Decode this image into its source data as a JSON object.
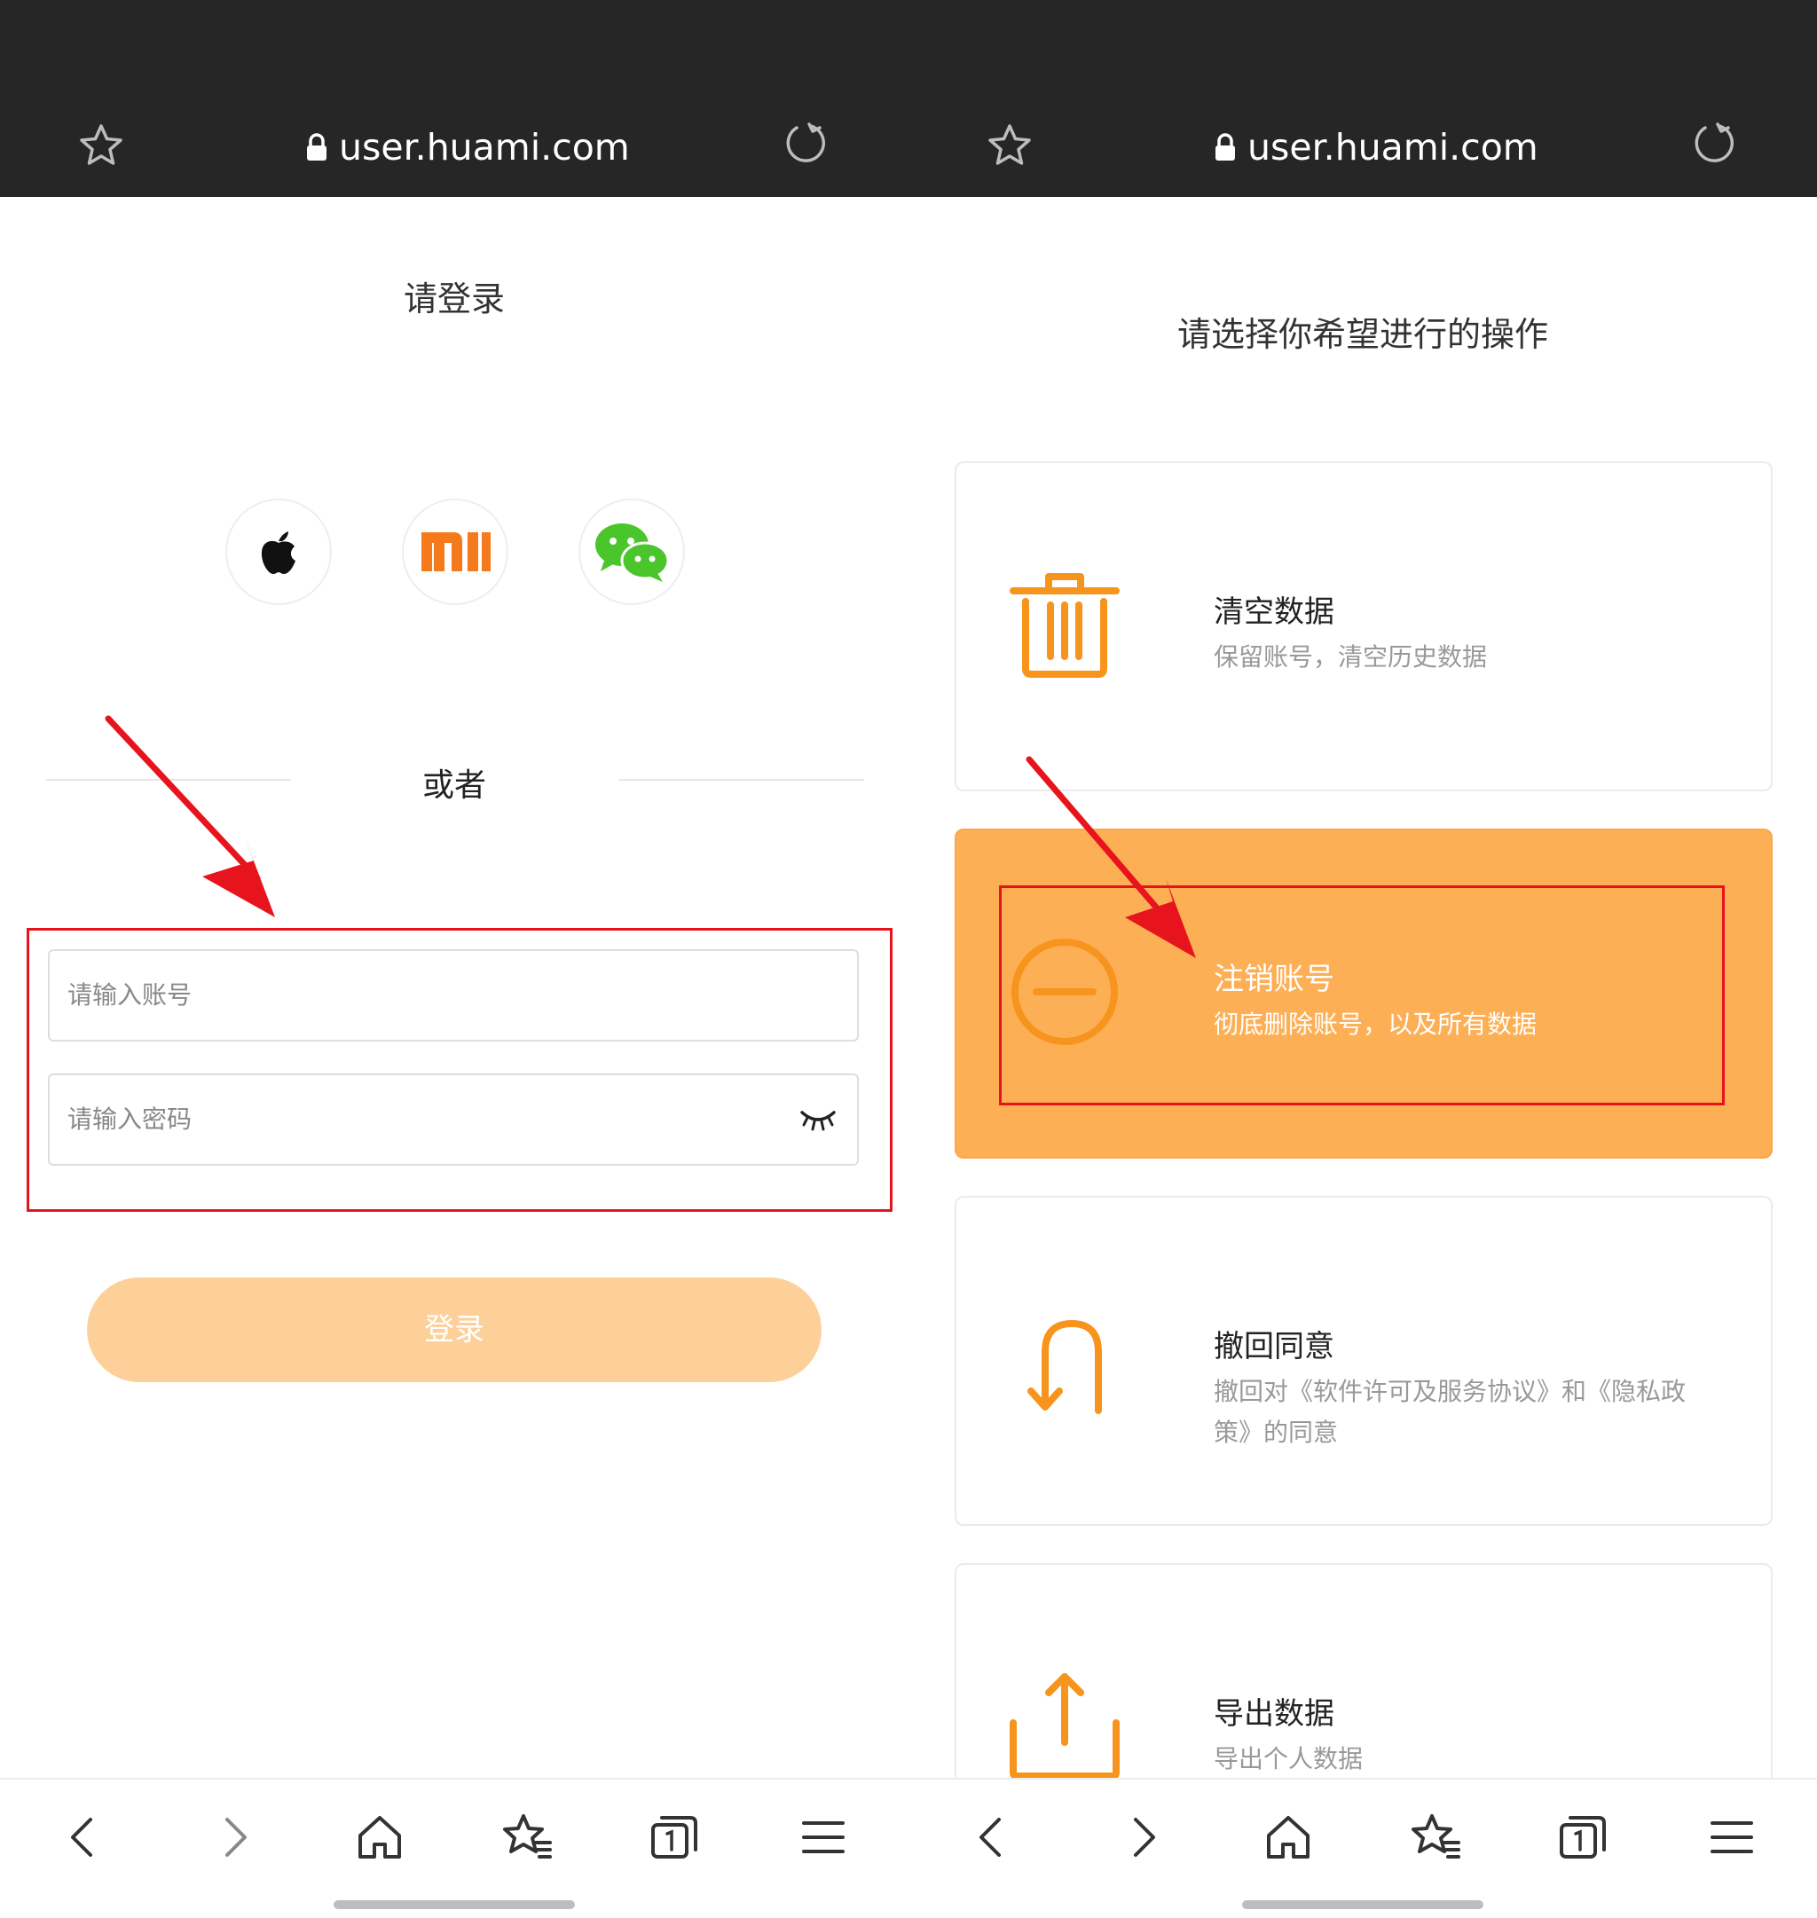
{
  "browser": {
    "url": "user.huami.com"
  },
  "login": {
    "title": "请登录",
    "social_options": [
      "apple",
      "xiaomi",
      "wechat"
    ],
    "separator": "或者",
    "account_placeholder": "请输入账号",
    "password_placeholder": "请输入密码",
    "login_button": "登录"
  },
  "operations": {
    "title": "请选择你希望进行的操作",
    "options": [
      {
        "title": "清空数据",
        "description": "保留账号，清空历史数据",
        "icon": "trash-icon"
      },
      {
        "title": "注销账号",
        "description": "彻底删除账号，以及所有数据",
        "icon": "minus-circle-icon",
        "selected": true
      },
      {
        "title": "撤回同意",
        "description": "撤回对《软件许可及服务协议》和《隐私政策》的同意",
        "icon": "undo-icon"
      },
      {
        "title": "导出数据",
        "description": "导出个人数据",
        "icon": "export-icon"
      }
    ]
  },
  "colors": {
    "accent": "#fdaf56",
    "icon_orange": "#f7941d",
    "annotation_red": "#e8141d",
    "topbar": "#262626",
    "login_button": "#fdd09a"
  }
}
